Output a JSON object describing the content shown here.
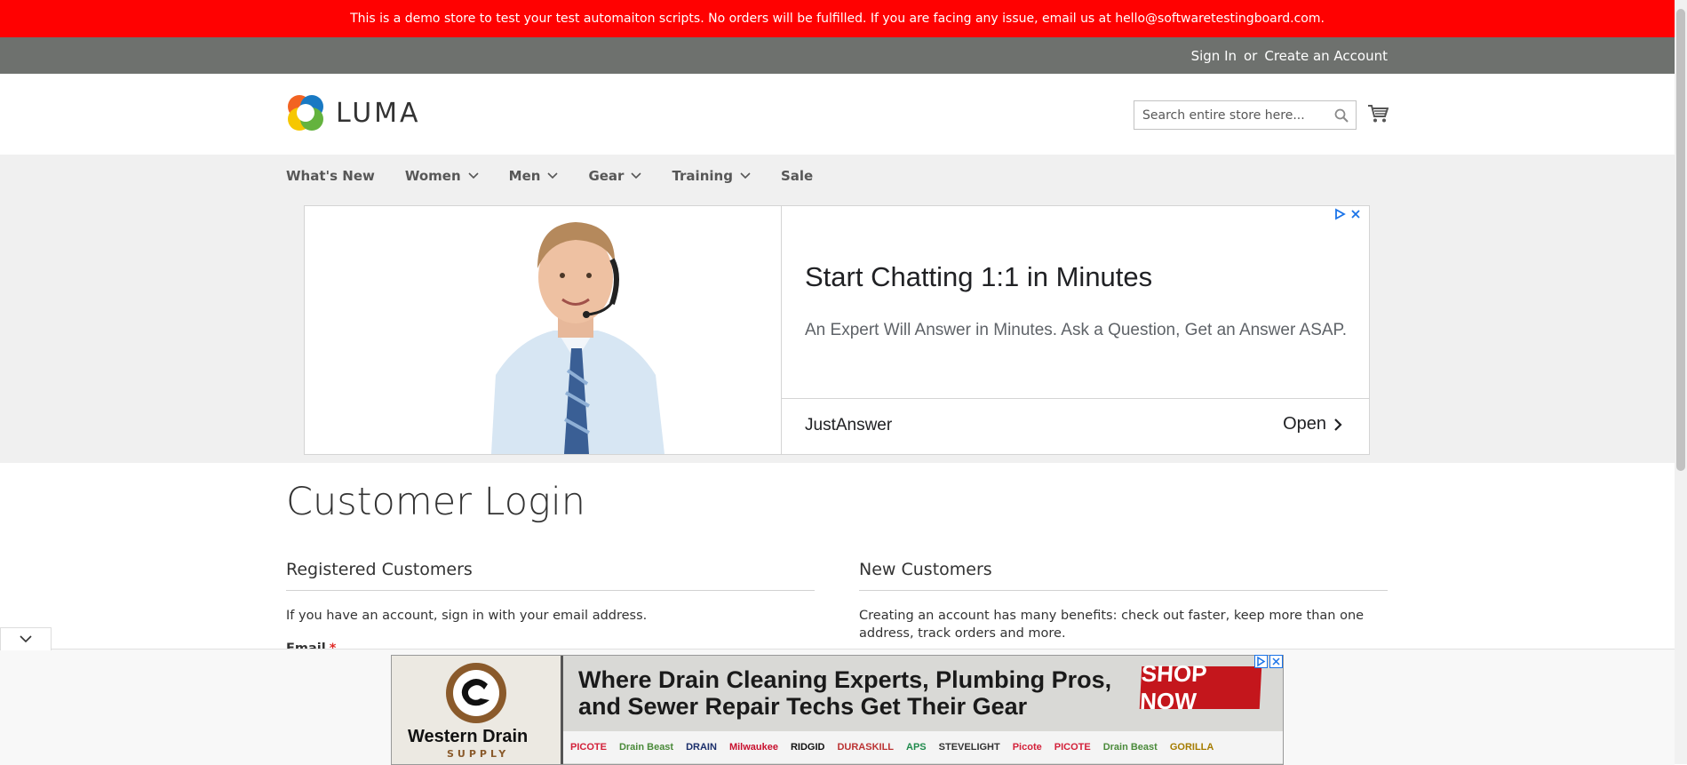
{
  "banner": {
    "text": "This is a demo store to test your test automaiton scripts. No orders will be fulfilled. If you are facing any issue, email us at hello@softwaretestingboard.com."
  },
  "top_links": {
    "sign_in": "Sign In",
    "or": "or",
    "create_account": "Create an Account"
  },
  "header": {
    "logo_text": "LUMA",
    "search_placeholder": "Search entire store here...",
    "cart_icon": "cart-icon"
  },
  "nav": {
    "items": [
      {
        "label": "What's New",
        "has_dropdown": false
      },
      {
        "label": "Women",
        "has_dropdown": true
      },
      {
        "label": "Men",
        "has_dropdown": true
      },
      {
        "label": "Gear",
        "has_dropdown": true
      },
      {
        "label": "Training",
        "has_dropdown": true
      },
      {
        "label": "Sale",
        "has_dropdown": false
      }
    ]
  },
  "ad": {
    "headline": "Start Chatting 1:1 in Minutes",
    "subtext": "An Expert Will Answer in Minutes. Ask a Question, Get an Answer ASAP.",
    "advertiser": "JustAnswer",
    "cta": "Open"
  },
  "main": {
    "page_title": "Customer Login",
    "registered": {
      "title": "Registered Customers",
      "text": "If you have an account, sign in with your email address.",
      "email_label": "Email",
      "required_mark": "*"
    },
    "new_customers": {
      "title": "New Customers",
      "text": "Creating an account has many benefits: check out faster, keep more than one address, track orders and more."
    }
  },
  "bottom_ad": {
    "brand_name": "Western Drain",
    "brand_sub": "SUPPLY",
    "headline_line1": "Where Drain Cleaning Experts, Plumbing Pros,",
    "headline_line2": "and Sewer Repair Techs Get Their Gear",
    "cta": "SHOP NOW",
    "brands": [
      "PICOTE",
      "Drain Beast",
      "DRAIN",
      "Milwaukee",
      "RIDGID",
      "DURASKILL",
      "APS",
      "STEVELIGHT",
      "Picote",
      "PICOTE",
      "Drain Beast",
      "GORILLA"
    ]
  },
  "colors": {
    "banner": "#ff0101",
    "top_bar": "#6e716e",
    "nav_bg": "#f0f0f0",
    "required": "#e02b27",
    "shop_now": "#c4161c"
  }
}
